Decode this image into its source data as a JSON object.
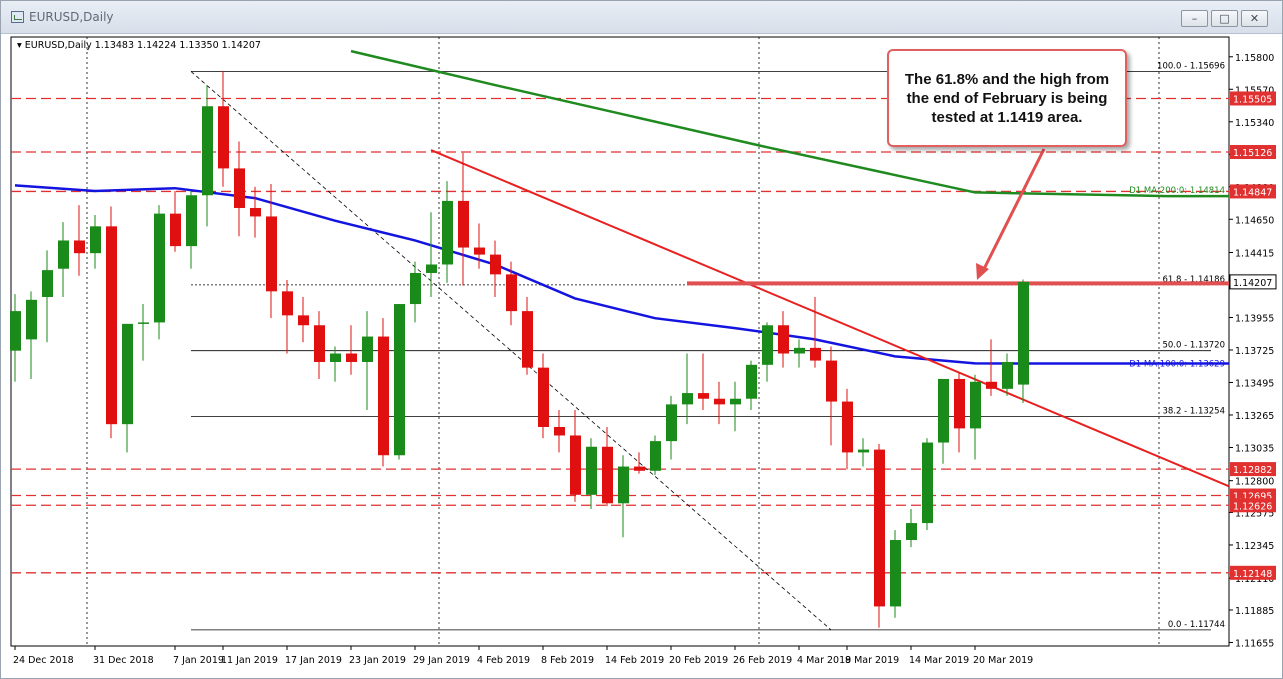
{
  "window": {
    "title": "EURUSD,Daily"
  },
  "chart_data": {
    "type": "candlestick",
    "header": "EURUSD,Daily  1.13483 1.14224 1.13350 1.14207",
    "ylim": [
      1.1163,
      1.1594
    ],
    "price_ticks": [
      "1.15800",
      "1.15570",
      "1.15340",
      "1.15110",
      "1.14880",
      "1.14650",
      "1.14415",
      "1.14185",
      "1.13955",
      "1.13725",
      "1.13495",
      "1.13265",
      "1.13035",
      "1.12800",
      "1.12575",
      "1.12345",
      "1.12110",
      "1.11885",
      "1.11655"
    ],
    "date_labels": [
      "24 Dec 2018",
      "31 Dec 2018",
      "7 Jan 2019",
      "11 Jan 2019",
      "17 Jan 2019",
      "23 Jan 2019",
      "29 Jan 2019",
      "4 Feb 2019",
      "8 Feb 2019",
      "14 Feb 2019",
      "20 Feb 2019",
      "26 Feb 2019",
      "4 Mar 2019",
      "8 Mar 2019",
      "14 Mar 2019",
      "20 Mar 2019"
    ],
    "candles": [
      [
        1.1372,
        1.1412,
        1.135,
        1.14
      ],
      [
        1.138,
        1.1414,
        1.1352,
        1.1408
      ],
      [
        1.141,
        1.1443,
        1.1378,
        1.1429
      ],
      [
        1.143,
        1.1463,
        1.141,
        1.145
      ],
      [
        1.145,
        1.1475,
        1.1425,
        1.1441
      ],
      [
        1.1441,
        1.1468,
        1.143,
        1.146
      ],
      [
        1.146,
        1.1474,
        1.131,
        1.132
      ],
      [
        1.132,
        1.1385,
        1.13,
        1.1391
      ],
      [
        1.1391,
        1.1405,
        1.1365,
        1.1392
      ],
      [
        1.1392,
        1.1475,
        1.138,
        1.1469
      ],
      [
        1.1469,
        1.1485,
        1.1442,
        1.1446
      ],
      [
        1.1446,
        1.1485,
        1.143,
        1.1482
      ],
      [
        1.1482,
        1.156,
        1.146,
        1.1545
      ],
      [
        1.1545,
        1.157,
        1.1488,
        1.1501
      ],
      [
        1.1501,
        1.152,
        1.1453,
        1.1473
      ],
      [
        1.1473,
        1.1488,
        1.1452,
        1.1467
      ],
      [
        1.1467,
        1.149,
        1.1395,
        1.1414
      ],
      [
        1.1414,
        1.1422,
        1.137,
        1.1397
      ],
      [
        1.1397,
        1.141,
        1.1378,
        1.139
      ],
      [
        1.139,
        1.14,
        1.1352,
        1.1364
      ],
      [
        1.1364,
        1.1375,
        1.135,
        1.137
      ],
      [
        1.137,
        1.139,
        1.1355,
        1.1364
      ],
      [
        1.1364,
        1.14,
        1.133,
        1.1382
      ],
      [
        1.1382,
        1.1395,
        1.129,
        1.1298
      ],
      [
        1.1298,
        1.1405,
        1.1295,
        1.1405
      ],
      [
        1.1405,
        1.1435,
        1.1392,
        1.1427
      ],
      [
        1.1427,
        1.147,
        1.141,
        1.1433
      ],
      [
        1.1433,
        1.1492,
        1.142,
        1.1478
      ],
      [
        1.1478,
        1.1512,
        1.1418,
        1.1445
      ],
      [
        1.1445,
        1.1462,
        1.143,
        1.144
      ],
      [
        1.144,
        1.145,
        1.141,
        1.1426
      ],
      [
        1.1426,
        1.1435,
        1.139,
        1.14
      ],
      [
        1.14,
        1.141,
        1.1355,
        1.136
      ],
      [
        1.136,
        1.137,
        1.131,
        1.1318
      ],
      [
        1.1318,
        1.133,
        1.13,
        1.1312
      ],
      [
        1.1312,
        1.133,
        1.1265,
        1.127
      ],
      [
        1.127,
        1.131,
        1.126,
        1.1304
      ],
      [
        1.1304,
        1.1318,
        1.1262,
        1.1264
      ],
      [
        1.1264,
        1.1298,
        1.124,
        1.129
      ],
      [
        1.129,
        1.13,
        1.1285,
        1.1287
      ],
      [
        1.1287,
        1.1312,
        1.1284,
        1.1308
      ],
      [
        1.1308,
        1.134,
        1.1295,
        1.1334
      ],
      [
        1.1334,
        1.137,
        1.132,
        1.1342
      ],
      [
        1.1342,
        1.137,
        1.133,
        1.1338
      ],
      [
        1.1338,
        1.135,
        1.132,
        1.1334
      ],
      [
        1.1334,
        1.135,
        1.1315,
        1.1338
      ],
      [
        1.1338,
        1.1365,
        1.133,
        1.1362
      ],
      [
        1.1362,
        1.1392,
        1.135,
        1.139
      ],
      [
        1.139,
        1.14,
        1.136,
        1.137
      ],
      [
        1.137,
        1.138,
        1.136,
        1.1374
      ],
      [
        1.1374,
        1.141,
        1.136,
        1.1365
      ],
      [
        1.1365,
        1.1375,
        1.1305,
        1.1336
      ],
      [
        1.1336,
        1.1345,
        1.1288,
        1.13
      ],
      [
        1.13,
        1.131,
        1.129,
        1.1302
      ],
      [
        1.1302,
        1.1306,
        1.1176,
        1.1191
      ],
      [
        1.1191,
        1.1245,
        1.1183,
        1.1238
      ],
      [
        1.1238,
        1.126,
        1.1233,
        1.125
      ],
      [
        1.125,
        1.131,
        1.1245,
        1.1307
      ],
      [
        1.1307,
        1.1345,
        1.1292,
        1.1352
      ],
      [
        1.1352,
        1.1356,
        1.13,
        1.1317
      ],
      [
        1.1317,
        1.1355,
        1.1295,
        1.135
      ],
      [
        1.135,
        1.138,
        1.134,
        1.1345
      ],
      [
        1.1345,
        1.137,
        1.134,
        1.1364
      ],
      [
        1.1348,
        1.14224,
        1.1335,
        1.14207
      ]
    ],
    "dashed_levels": [
      "1.15505",
      "1.15126",
      "1.14847",
      "1.12882",
      "1.12695",
      "1.12626",
      "1.12148"
    ],
    "current_price": "1.14207",
    "fibonacci": [
      {
        "label": "100.0 - 1.15696",
        "value": 1.15696
      },
      {
        "label": "61.8 - 1.14186",
        "value": 1.14186
      },
      {
        "label": "50.0 - 1.13720",
        "value": 1.1372
      },
      {
        "label": "38.2 - 1.13254",
        "value": 1.13254
      },
      {
        "label": "0.0 - 1.11744",
        "value": 1.11744
      }
    ],
    "ma200": {
      "label": "D1 MA:200:0: 1.14814",
      "value": 1.14814
    },
    "ma100": {
      "label": "D1 MA:100:0: 1.13629",
      "value": 1.13629
    },
    "colors": {
      "bull": "#1a8a1a",
      "bear": "#e01010",
      "ma100": "#1414e0",
      "ma200": "#1f8a1f",
      "trendline": "#e82020",
      "level_box": "#e03030",
      "grid": "#000000"
    },
    "annotation": "The 61.8% and the high from the end of February is being tested at 1.1419 area."
  }
}
